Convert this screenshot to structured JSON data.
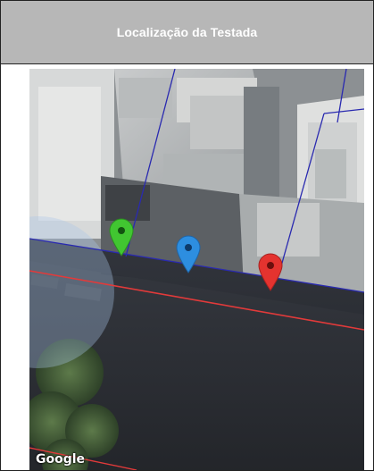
{
  "header": {
    "title": "Localização da Testada"
  },
  "map": {
    "attribution": "Google",
    "markers": [
      {
        "name": "marker-green",
        "color": "#41c631"
      },
      {
        "name": "marker-blue",
        "color": "#2d8ee0"
      },
      {
        "name": "marker-red",
        "color": "#e4332f"
      }
    ],
    "boundary_color": "#2a2ab0",
    "testada_line_color": "#e23a3a"
  }
}
